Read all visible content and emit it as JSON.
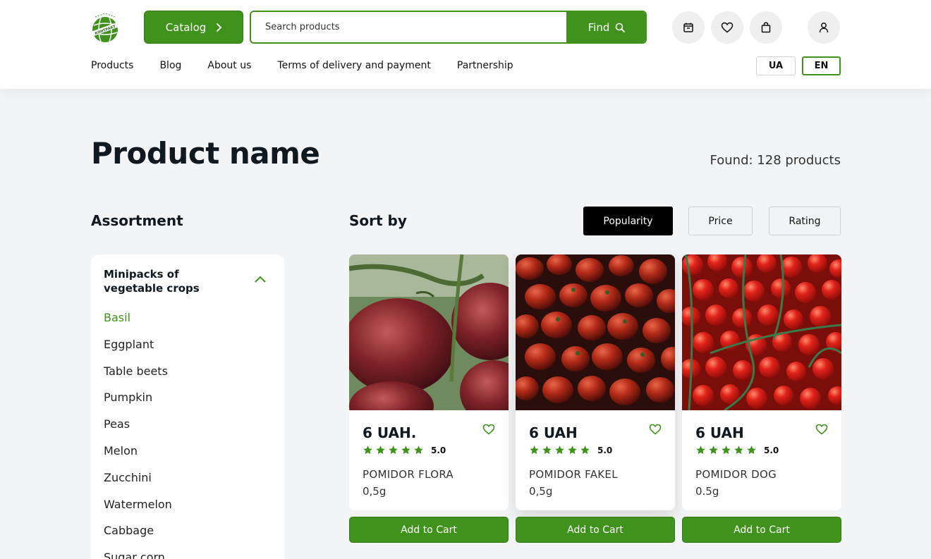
{
  "header": {
    "logo_text": "КОНТРАКТ",
    "catalog_label": "Catalog",
    "search_placeholder": "Search products",
    "find_label": "Find",
    "nav": [
      "Products",
      "Blog",
      "About us",
      "Terms of delivery and payment",
      "Partnership"
    ],
    "languages": [
      "UA",
      "EN"
    ],
    "active_language": "EN"
  },
  "page": {
    "title": "Product name",
    "found": "Found: 128 products"
  },
  "sidebar": {
    "heading": "Assortment",
    "category": "Minipacks of vegetable crops",
    "items": [
      "Basil",
      "Eggplant",
      "Table beets",
      "Pumpkin",
      "Peas",
      "Melon",
      "Zucchini",
      "Watermelon",
      "Cabbage",
      "Sugar corn"
    ],
    "active_item": "Basil"
  },
  "sort": {
    "label": "Sort by",
    "options": [
      "Popularity",
      "Price",
      "Rating"
    ],
    "active": "Popularity"
  },
  "products": [
    {
      "price": "6 UAH.",
      "rating": "5.0",
      "stars": 5,
      "name": "POMIDOR FLORA",
      "weight": "0,5g",
      "cart_label": "Add to Cart"
    },
    {
      "price": "6 UAH",
      "rating": "5.0",
      "stars": 5,
      "name": "POMIDOR FAKEL",
      "weight": "0,5g",
      "cart_label": "Add to Cart"
    },
    {
      "price": "6 UAH",
      "rating": "5.0",
      "stars": 5,
      "name": "POMIDOR DOG",
      "weight": "0.5g",
      "cart_label": "Add to Cart"
    }
  ],
  "colors": {
    "accent": "#3f921b",
    "text": "#101820",
    "background": "#f3f4f6"
  }
}
